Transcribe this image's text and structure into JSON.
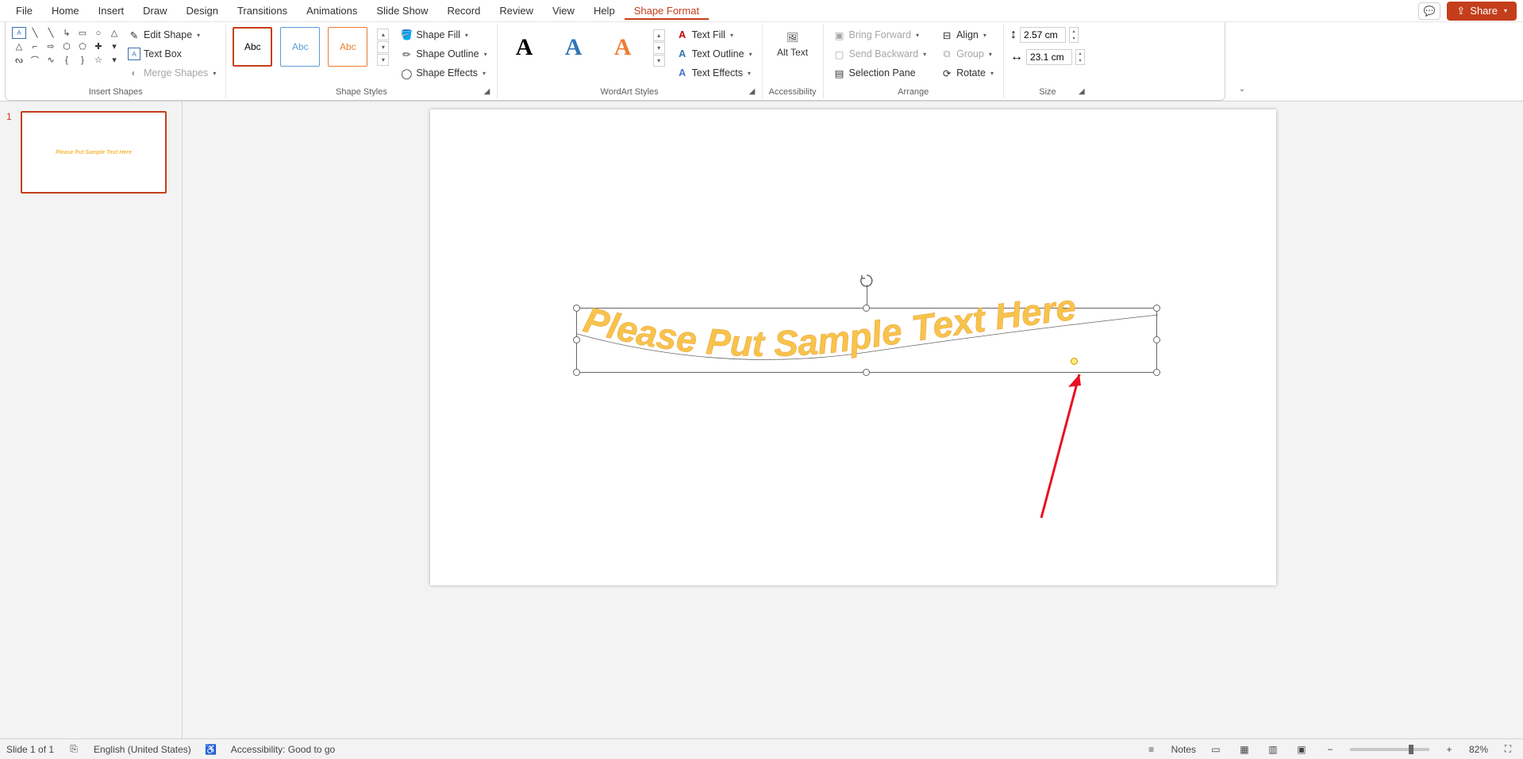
{
  "menu": {
    "items": [
      "File",
      "Home",
      "Insert",
      "Draw",
      "Design",
      "Transitions",
      "Animations",
      "Slide Show",
      "Record",
      "Review",
      "View",
      "Help",
      "Shape Format"
    ],
    "active_index": 12,
    "share": "Share"
  },
  "ribbon": {
    "insert_shapes": {
      "edit_shape": "Edit Shape",
      "text_box": "Text Box",
      "merge_shapes": "Merge Shapes",
      "label": "Insert Shapes"
    },
    "shape_styles": {
      "previews": [
        "Abc",
        "Abc",
        "Abc"
      ],
      "fill": "Shape Fill",
      "outline": "Shape Outline",
      "effects": "Shape Effects",
      "label": "Shape Styles"
    },
    "wordart": {
      "text_fill": "Text Fill",
      "text_outline": "Text Outline",
      "text_effects": "Text Effects",
      "label": "WordArt Styles"
    },
    "accessibility": {
      "alt_text": "Alt Text",
      "label": "Accessibility"
    },
    "arrange": {
      "bring_forward": "Bring Forward",
      "send_backward": "Send Backward",
      "selection_pane": "Selection Pane",
      "align": "Align",
      "group": "Group",
      "rotate": "Rotate",
      "label": "Arrange"
    },
    "size": {
      "height": "2.57 cm",
      "width": "23.1 cm",
      "label": "Size"
    }
  },
  "slide_text": "Please Put Sample Text Here",
  "thumb_index": "1",
  "status": {
    "slide": "Slide 1 of 1",
    "lang": "English (United States)",
    "acc": "Accessibility: Good to go",
    "notes": "Notes",
    "zoom": "82%"
  }
}
